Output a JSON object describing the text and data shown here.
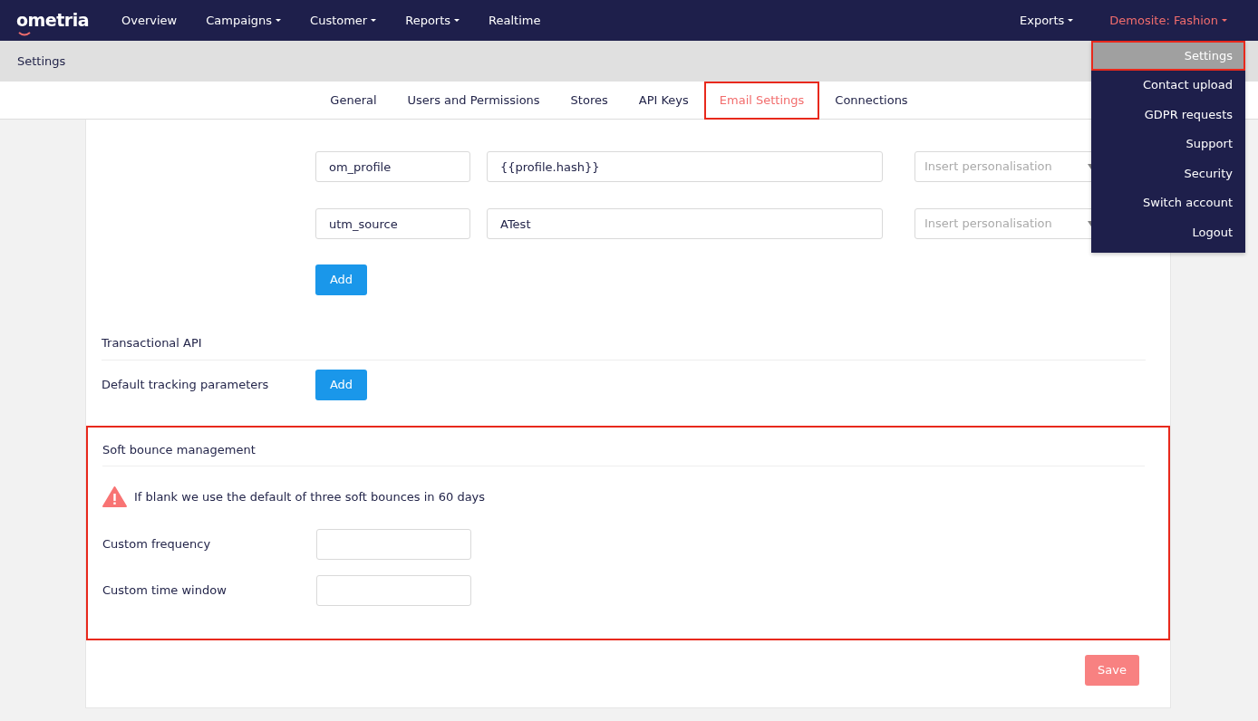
{
  "navbar": {
    "logo": "ometria",
    "items": [
      {
        "label": "Overview",
        "dropdown": false
      },
      {
        "label": "Campaigns",
        "dropdown": true
      },
      {
        "label": "Customer",
        "dropdown": true
      },
      {
        "label": "Reports",
        "dropdown": true
      },
      {
        "label": "Realtime",
        "dropdown": false
      }
    ],
    "right_items": [
      {
        "label": "Exports",
        "dropdown": true,
        "kind": "plain"
      },
      {
        "label": "Demosite: Fashion",
        "dropdown": true,
        "kind": "account"
      }
    ]
  },
  "breadcrumb": "Settings",
  "tabs": [
    {
      "label": "General",
      "selected": false,
      "highlighted": false
    },
    {
      "label": "Users and Permissions",
      "selected": false,
      "highlighted": false
    },
    {
      "label": "Stores",
      "selected": false,
      "highlighted": false
    },
    {
      "label": "API Keys",
      "selected": false,
      "highlighted": false
    },
    {
      "label": "Email Settings",
      "selected": true,
      "highlighted": true
    },
    {
      "label": "Connections",
      "selected": false,
      "highlighted": false
    }
  ],
  "menu": {
    "items": [
      {
        "label": "Settings",
        "selected": true,
        "highlighted": true
      },
      {
        "label": "Contact upload",
        "selected": false,
        "highlighted": false
      },
      {
        "label": "GDPR requests",
        "selected": false,
        "highlighted": false
      },
      {
        "label": "Support",
        "selected": false,
        "highlighted": false
      },
      {
        "label": "Security",
        "selected": false,
        "highlighted": false
      },
      {
        "label": "Switch account",
        "selected": false,
        "highlighted": false
      },
      {
        "label": "Logout",
        "selected": false,
        "highlighted": false
      }
    ]
  },
  "tracking_rows": [
    {
      "key": "om_profile",
      "value": "{{profile.hash}}",
      "placeholder": "Insert personalisation"
    },
    {
      "key": "utm_source",
      "value": "ATest",
      "placeholder": "Insert personalisation"
    }
  ],
  "add_button": "Add",
  "transactional": {
    "title": "Transactional API",
    "label": "Default tracking parameters",
    "button": "Add"
  },
  "soft_bounce": {
    "title": "Soft bounce management",
    "highlighted": true,
    "warning": "If blank we use the default of three soft bounces in 60 days",
    "fields": [
      {
        "label": "Custom frequency"
      },
      {
        "label": "Custom time window"
      }
    ]
  },
  "save_button": "Save"
}
